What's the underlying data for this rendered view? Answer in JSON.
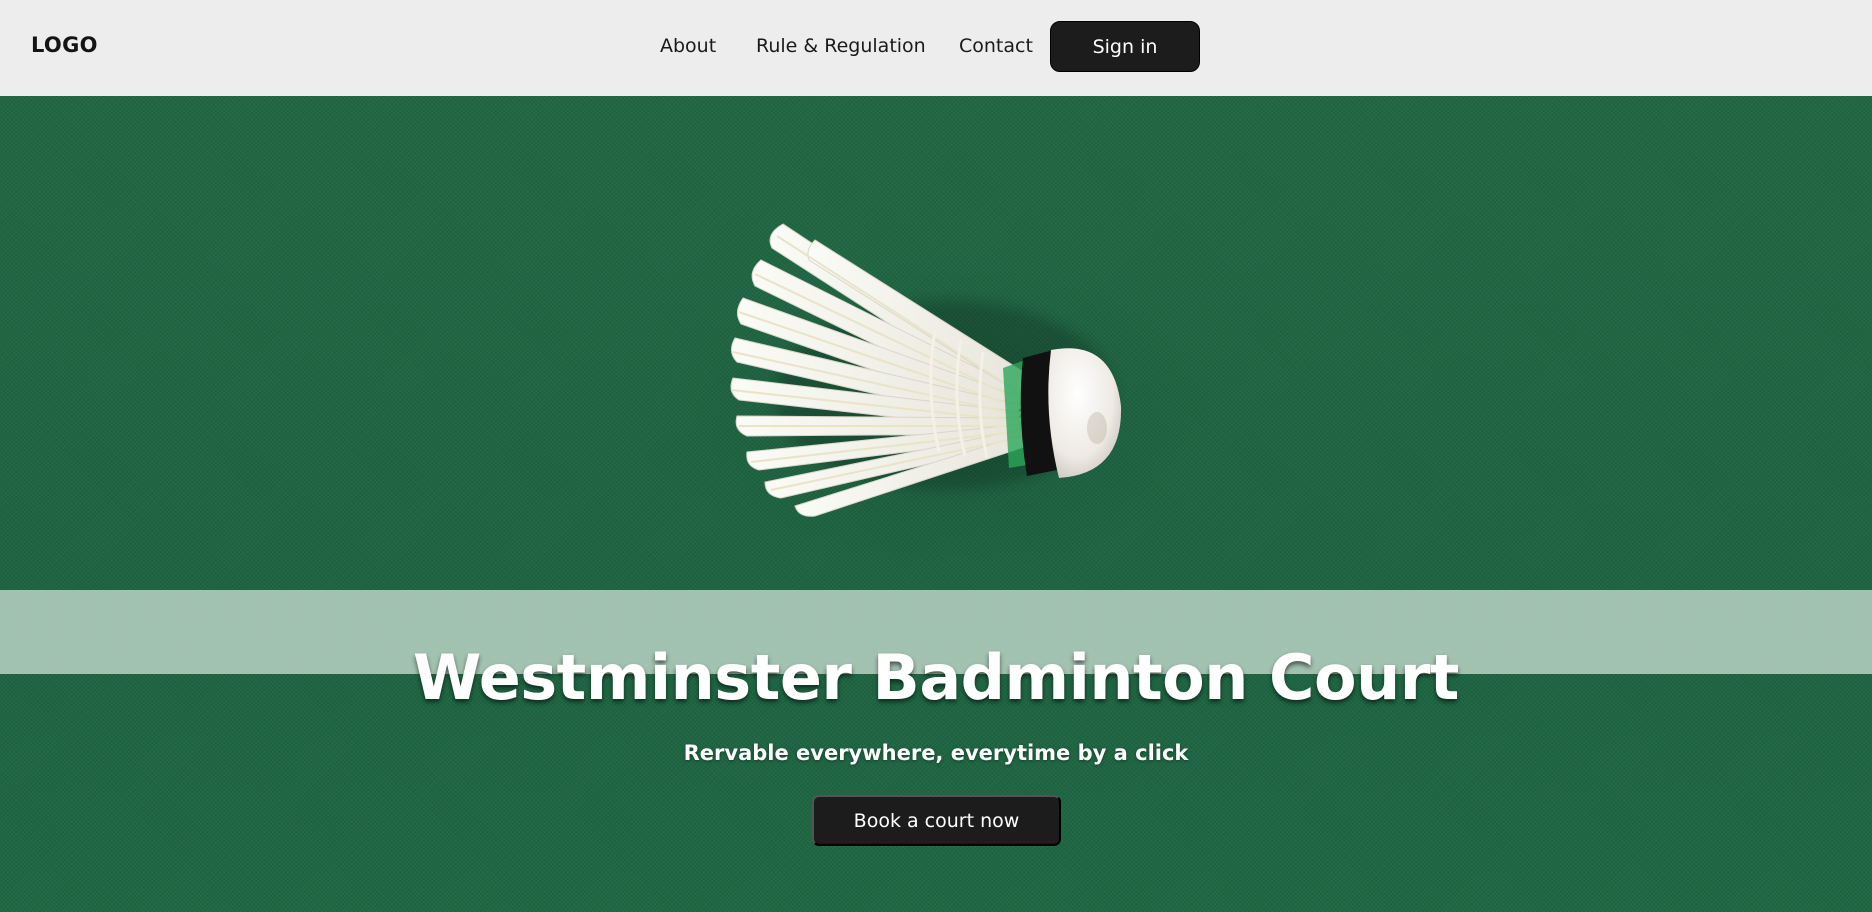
{
  "header": {
    "logo": "LOGO",
    "nav": [
      {
        "label": "About"
      },
      {
        "label": "Rule & Regulation"
      },
      {
        "label": "Contact"
      }
    ],
    "sign_in_label": "Sign in"
  },
  "hero": {
    "background_color": "#1e6541",
    "image": "badminton-shuttlecock",
    "title": "Westminster Badminton Court",
    "subtitle": "Rervable everywhere, everytime by a click",
    "cta_label": "Book a court now"
  }
}
